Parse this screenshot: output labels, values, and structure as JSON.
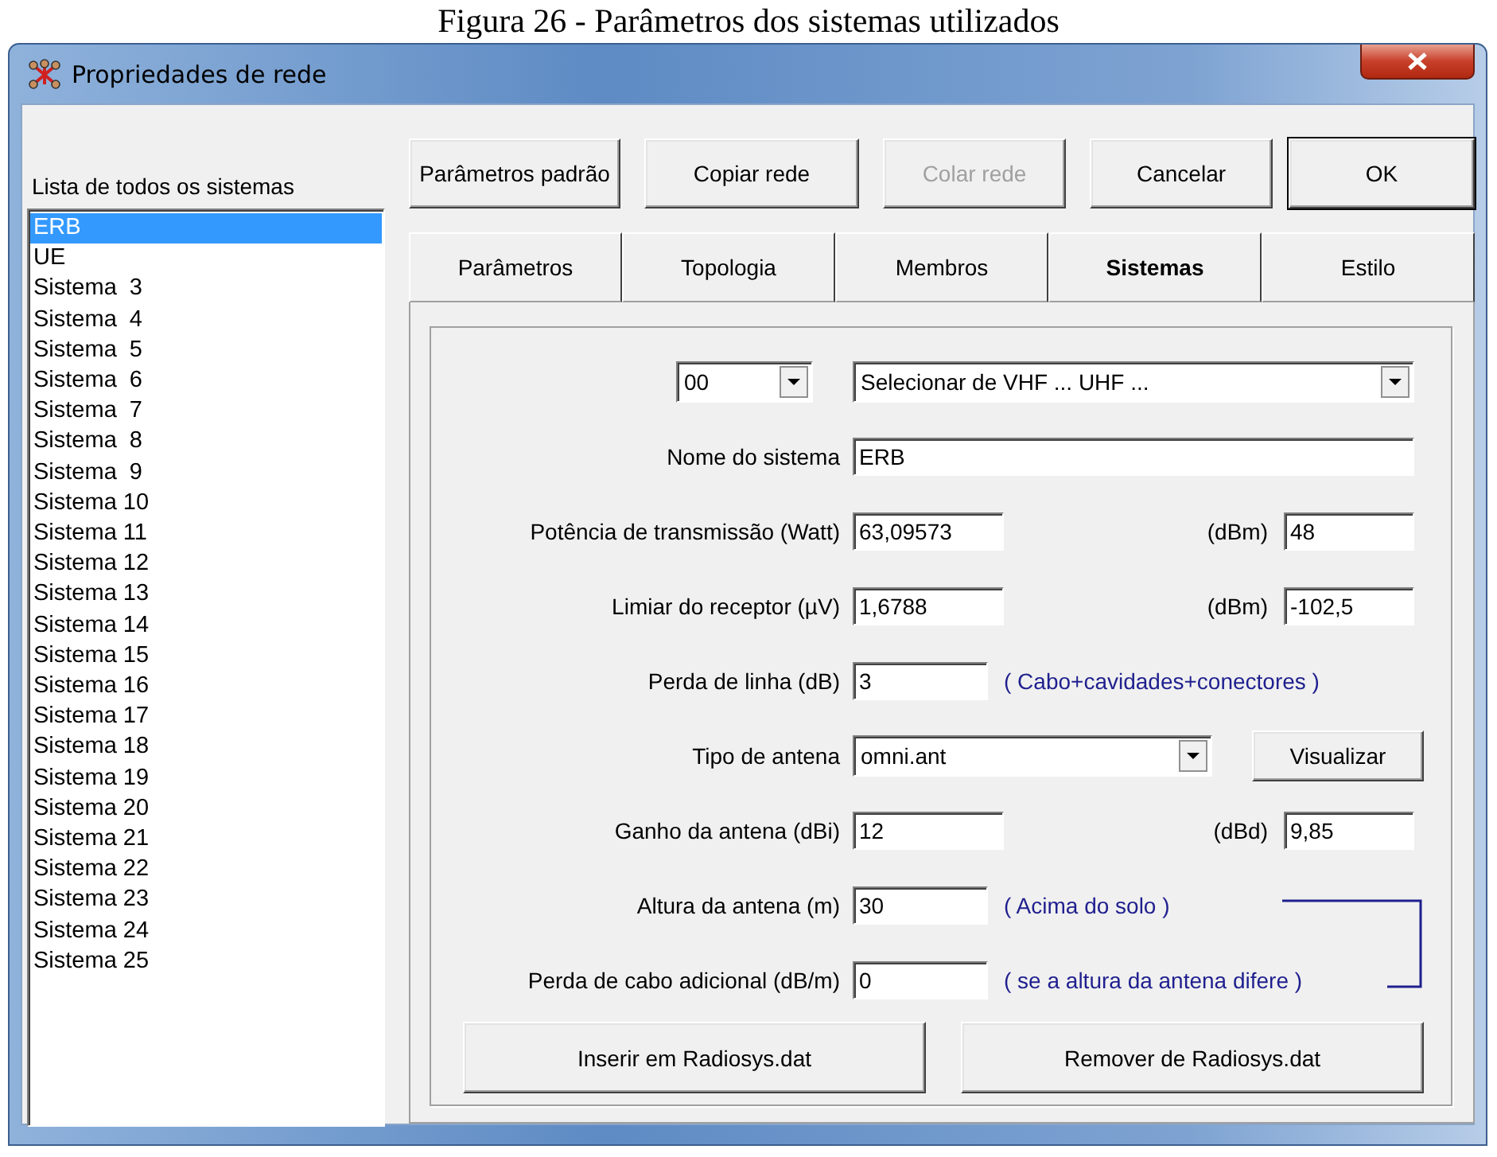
{
  "caption": "Figura 26 - Parâmetros dos sistemas utilizados",
  "window": {
    "title": "Propriedades de rede"
  },
  "systems_list": {
    "label": "Lista de todos os sistemas",
    "items": [
      {
        "label": "ERB",
        "selected": true
      },
      {
        "label": "UE",
        "selected": false
      },
      {
        "label": "Sistema  3",
        "selected": false
      },
      {
        "label": "Sistema  4",
        "selected": false
      },
      {
        "label": "Sistema  5",
        "selected": false
      },
      {
        "label": "Sistema  6",
        "selected": false
      },
      {
        "label": "Sistema  7",
        "selected": false
      },
      {
        "label": "Sistema  8",
        "selected": false
      },
      {
        "label": "Sistema  9",
        "selected": false
      },
      {
        "label": "Sistema 10",
        "selected": false
      },
      {
        "label": "Sistema 11",
        "selected": false
      },
      {
        "label": "Sistema 12",
        "selected": false
      },
      {
        "label": "Sistema 13",
        "selected": false
      },
      {
        "label": "Sistema 14",
        "selected": false
      },
      {
        "label": "Sistema 15",
        "selected": false
      },
      {
        "label": "Sistema 16",
        "selected": false
      },
      {
        "label": "Sistema 17",
        "selected": false
      },
      {
        "label": "Sistema 18",
        "selected": false
      },
      {
        "label": "Sistema 19",
        "selected": false
      },
      {
        "label": "Sistema 20",
        "selected": false
      },
      {
        "label": "Sistema 21",
        "selected": false
      },
      {
        "label": "Sistema 22",
        "selected": false
      },
      {
        "label": "Sistema 23",
        "selected": false
      },
      {
        "label": "Sistema 24",
        "selected": false
      },
      {
        "label": "Sistema 25",
        "selected": false
      }
    ]
  },
  "buttons": [
    {
      "label": "Parâmetros padrão",
      "disabled": false,
      "default": false
    },
    {
      "label": "Copiar rede",
      "disabled": false,
      "default": false
    },
    {
      "label": "Colar rede",
      "disabled": true,
      "default": false
    },
    {
      "label": "Cancelar",
      "disabled": false,
      "default": false
    },
    {
      "label": "OK",
      "disabled": false,
      "default": true
    }
  ],
  "tabs": [
    {
      "label": "Parâmetros",
      "selected": false
    },
    {
      "label": "Topologia",
      "selected": false
    },
    {
      "label": "Membros",
      "selected": false
    },
    {
      "label": "Sistemas",
      "selected": true
    },
    {
      "label": "Estilo",
      "selected": false
    }
  ],
  "form": {
    "preset_code": "00",
    "preset_source": "Selecionar de VHF ... UHF ...",
    "rows": [
      {
        "kind": "wide",
        "label": "Nome do sistema",
        "value": "ERB"
      },
      {
        "kind": "pair",
        "label": "Potência de transmissão (Watt)",
        "value": "63,09573",
        "unit": "(dBm)",
        "value2": "48"
      },
      {
        "kind": "pair",
        "label": "Limiar do receptor (µV)",
        "value": "1,6788",
        "unit": "(dBm)",
        "value2": "-102,5"
      },
      {
        "kind": "note",
        "label": "Perda de linha (dB)",
        "value": "3",
        "note": "( Cabo+cavidades+conectores )"
      },
      {
        "kind": "select",
        "label": "Tipo de antena",
        "value": "omni.ant",
        "button": "Visualizar"
      },
      {
        "kind": "pair",
        "label": "Ganho da antena (dBi)",
        "value": "12",
        "unit": "(dBd)",
        "value2": "9,85"
      },
      {
        "kind": "note",
        "label": "Altura da antena (m)",
        "value": "30",
        "note": "( Acima do solo )"
      },
      {
        "kind": "note",
        "label": "Perda de cabo adicional (dB/m)",
        "value": "0",
        "note": "( se a altura da antena difere )"
      }
    ],
    "actions": [
      "Inserir em Radiosys.dat",
      "Remover de Radiosys.dat"
    ]
  }
}
